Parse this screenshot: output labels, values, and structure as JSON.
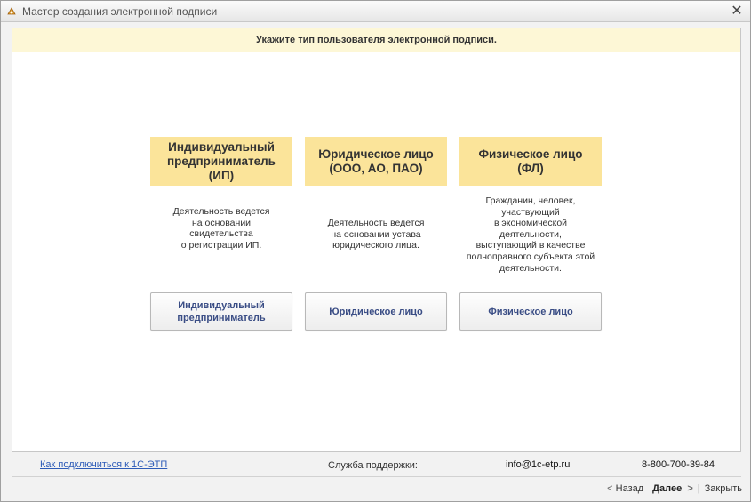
{
  "window": {
    "title": "Мастер создания электронной подписи",
    "icon": "app-icon",
    "close_glyph": "✕"
  },
  "banner": {
    "text": "Укажите тип пользователя электронной подписи."
  },
  "options": [
    {
      "header": "Индивидуальный\nпредприниматель\n(ИП)",
      "description": "Деятельность ведется\nна основании\nсвидетельства\nо регистрации ИП.",
      "button": "Индивидуальный\nпредприниматель"
    },
    {
      "header": "Юридическое лицо\n(ООО, АО, ПАО)",
      "description": "Деятельность ведется\nна основании устава\nюридического лица.",
      "button": "Юридическое лицо"
    },
    {
      "header": "Физическое лицо\n(ФЛ)",
      "description": "Гражданин, человек,\nучаствующий\nв экономической\nдеятельности,\nвыступающий в качестве\nполноправного субъекта этой\nдеятельности.",
      "button": "Физическое лицо"
    }
  ],
  "footer": {
    "link": "Как подключиться к 1С-ЭТП",
    "support_label": "Служба поддержки:",
    "email": "info@1c-etp.ru",
    "phone": "8-800-700-39-84"
  },
  "nav": {
    "back_arrow": "<",
    "back": "Назад",
    "next": "Далее",
    "next_arrow": ">",
    "separator": "|",
    "close": "Закрыть"
  },
  "colors": {
    "banner_bg": "#fdf7d6",
    "header_bg": "#fbe49a",
    "button_text": "#3a4d85",
    "link": "#2e5cb8"
  }
}
